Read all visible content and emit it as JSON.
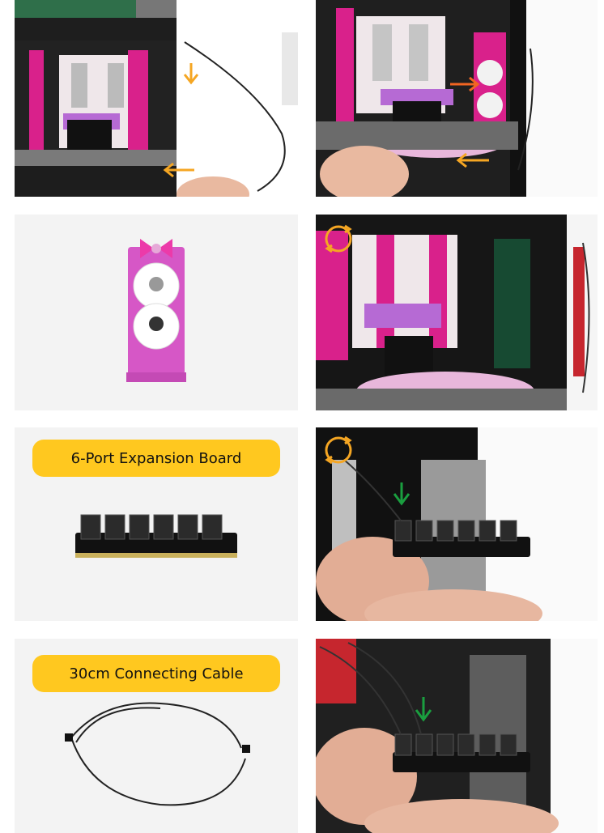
{
  "steps": {
    "expansion_board_label": "6-Port Expansion Board",
    "connecting_cable_label": "30cm Connecting Cable"
  },
  "colors": {
    "pill": "#ffc81f",
    "orange_arrow": "#f5a623",
    "red_arrow": "#f26522",
    "green_arrow": "#1a9e3f",
    "panel_bg": "#f3f3f3"
  }
}
